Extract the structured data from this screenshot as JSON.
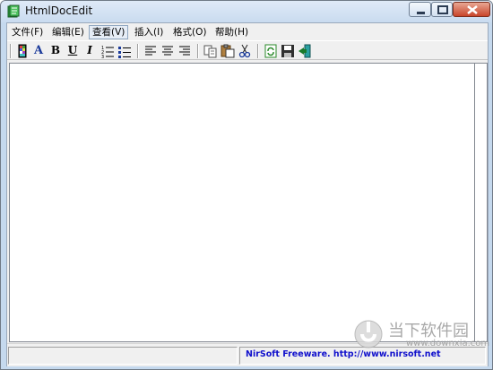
{
  "window": {
    "title": "HtmlDocEdit",
    "minimize_icon": "minimize-icon",
    "maximize_icon": "maximize-icon",
    "close_icon": "close-icon"
  },
  "menubar": {
    "items": [
      {
        "label": "文件(F)"
      },
      {
        "label": "编辑(E)"
      },
      {
        "label": "查看(V)"
      },
      {
        "label": "插入(I)"
      },
      {
        "label": "格式(O)"
      },
      {
        "label": "帮助(H)"
      }
    ],
    "active_index": 2
  },
  "toolbar": {
    "buttons": [
      {
        "icon": "color-palette-icon"
      },
      {
        "icon": "font-icon",
        "glyph": "A"
      },
      {
        "icon": "bold-icon",
        "glyph": "B"
      },
      {
        "icon": "underline-icon",
        "glyph": "U"
      },
      {
        "icon": "italic-icon",
        "glyph": "I"
      },
      {
        "icon": "numbered-list-icon"
      },
      {
        "icon": "bullet-list-icon"
      },
      {
        "icon": "align-left-icon"
      },
      {
        "icon": "align-center-icon"
      },
      {
        "icon": "align-right-icon"
      },
      {
        "icon": "copy-icon"
      },
      {
        "icon": "paste-icon"
      },
      {
        "icon": "cut-icon"
      },
      {
        "icon": "refresh-icon"
      },
      {
        "icon": "save-icon"
      },
      {
        "icon": "exit-icon"
      }
    ]
  },
  "editor": {
    "content": ""
  },
  "statusbar": {
    "left": "",
    "right": "NirSoft Freeware.  http://www.nirsoft.net"
  },
  "watermark": {
    "brand": "当下软件园",
    "url": "www.downxia.com"
  },
  "colors": {
    "accent": "#1010cc",
    "title_bar": "#c9dbef",
    "close_button": "#c9452a"
  }
}
